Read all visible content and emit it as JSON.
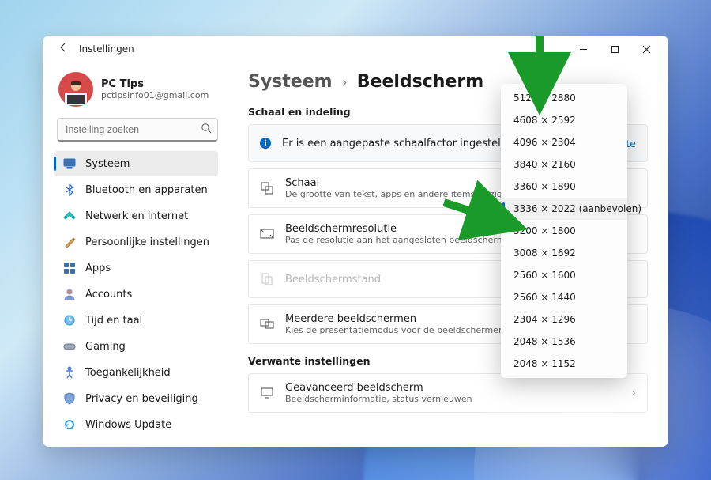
{
  "window": {
    "title": "Instellingen",
    "minimize_tooltip": "Minimaliseren",
    "maximize_tooltip": "Maximaliseren",
    "close_tooltip": "Sluiten"
  },
  "profile": {
    "name": "PC Tips",
    "email": "pctipsinfo01@gmail.com"
  },
  "search": {
    "placeholder": "Instelling zoeken"
  },
  "sidebar": {
    "items": [
      {
        "label": "Systeem",
        "icon": "display-icon",
        "selected": true
      },
      {
        "label": "Bluetooth en apparaten",
        "icon": "bluetooth-icon"
      },
      {
        "label": "Netwerk en internet",
        "icon": "wifi-icon"
      },
      {
        "label": "Persoonlijke instellingen",
        "icon": "paintbrush-icon"
      },
      {
        "label": "Apps",
        "icon": "apps-icon"
      },
      {
        "label": "Accounts",
        "icon": "account-icon"
      },
      {
        "label": "Tijd en taal",
        "icon": "clock-globe-icon"
      },
      {
        "label": "Gaming",
        "icon": "gamepad-icon"
      },
      {
        "label": "Toegankelijkheid",
        "icon": "accessibility-icon"
      },
      {
        "label": "Privacy en beveiliging",
        "icon": "shield-icon"
      },
      {
        "label": "Windows Update",
        "icon": "update-icon"
      }
    ]
  },
  "breadcrumb": {
    "parent": "Systeem",
    "current": "Beeldscherm"
  },
  "sections": {
    "scale_heading": "Schaal en indeling",
    "related_heading": "Verwante instellingen"
  },
  "info_banner": {
    "text": "Er is een aangepaste schaalfactor ingesteld.",
    "link": "Aangepaste"
  },
  "cards": {
    "scale": {
      "title": "Schaal",
      "sub": "De grootte van tekst, apps en andere items wijzigen"
    },
    "resolution": {
      "title": "Beeldschermresolutie",
      "sub": "Pas de resolutie aan het aangesloten beeldscherm aan"
    },
    "orientation": {
      "title": "Beeldschermstand"
    },
    "multi": {
      "title": "Meerdere beeldschermen",
      "sub": "Kies de presentatiemodus voor de beeldschermen"
    },
    "advanced": {
      "title": "Geavanceerd beeldscherm",
      "sub": "Beeldscherminformatie, status vernieuwen"
    }
  },
  "resolution_options": [
    {
      "label": "5120 × 2880"
    },
    {
      "label": "4608 × 2592"
    },
    {
      "label": "4096 × 2304"
    },
    {
      "label": "3840 × 2160"
    },
    {
      "label": "3360 × 1890"
    },
    {
      "label": "3336 × 2022 (aanbevolen)",
      "selected": true
    },
    {
      "label": "3200 × 1800"
    },
    {
      "label": "3008 × 1692"
    },
    {
      "label": "2560 × 1600"
    },
    {
      "label": "2560 × 1440"
    },
    {
      "label": "2304 × 1296"
    },
    {
      "label": "2048 × 1536"
    },
    {
      "label": "2048 × 1152"
    }
  ]
}
